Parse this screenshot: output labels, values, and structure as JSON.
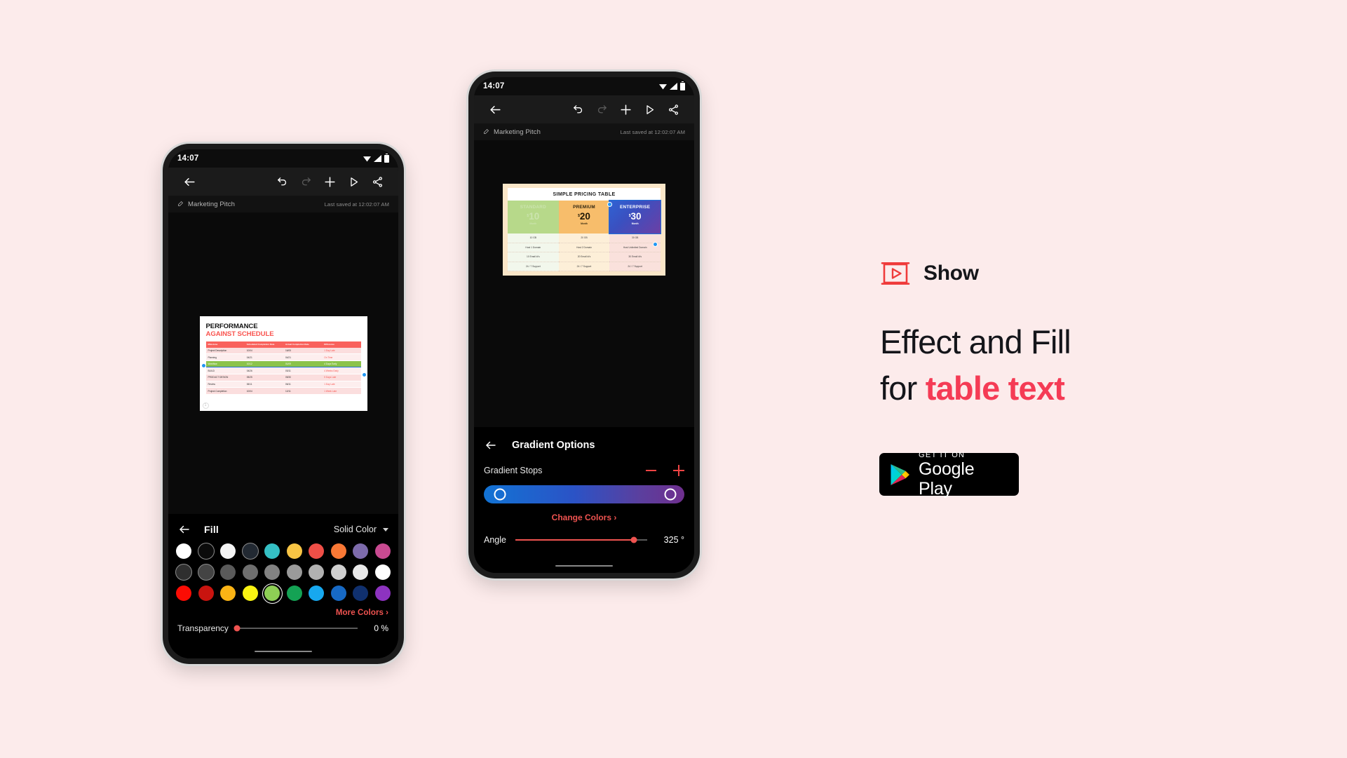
{
  "page": {
    "background": "#fcebeb"
  },
  "phone_left": {
    "status": {
      "time": "14:07",
      "icons": [
        "wifi-icon",
        "signal-icon",
        "battery-icon"
      ]
    },
    "toolbar": {
      "back": "back-arrow-icon",
      "undo": "undo-icon",
      "redo": "redo-icon",
      "add": "plus-icon",
      "present": "play-icon",
      "share": "share-icon"
    },
    "doc": {
      "title": "Marketing Pitch",
      "saved": "Last saved at 12:02:07 AM"
    },
    "slide": {
      "title_line1": "PERFORMANCE",
      "title_line2": "AGAINST SCHEDULE",
      "page_indicator": "1",
      "columns": [
        "Milestone",
        "Scheduled Completion Date",
        "Actual Completion Date",
        "Difference"
      ],
      "rows": [
        {
          "cells": [
            "Project Description",
            "10/04",
            "16/05",
            "1 Day Late"
          ],
          "selected": false
        },
        {
          "cells": [
            "Planning",
            "04/21",
            "04/21",
            "On Time"
          ],
          "selected": false
        },
        {
          "cells": [
            "Workflow",
            "10/12",
            "01/09",
            "4 Days Early"
          ],
          "selected": true
        },
        {
          "cells": [
            "BUILD",
            "04/26",
            "03/11",
            "4 Weeks Early"
          ],
          "selected": false
        },
        {
          "cells": [
            "PRODUCT DESIGN",
            "05/25",
            "05/30",
            "5 Days Late"
          ],
          "selected": false
        },
        {
          "cells": [
            "Review",
            "06/11",
            "06/11",
            "1 Day Late"
          ],
          "selected": false
        },
        {
          "cells": [
            "Project Completion",
            "10/04",
            "12/11",
            "1 Week Late"
          ],
          "selected": false
        }
      ]
    },
    "sheet": {
      "back": "back-arrow-icon",
      "title": "Fill",
      "mode": "Solid Color",
      "mode_caret": "chevron-down-icon",
      "swatch_rows": [
        [
          "#ffffff",
          "#0b0b0b",
          "#f5f5f5",
          "#222932",
          "#35bfc4",
          "#f7c444",
          "#ef4f47",
          "#f97835",
          "#7d6bab",
          "#c94a91"
        ],
        [
          "#2f2f2f",
          "#444444",
          "#5a5a5a",
          "#6e6e6e",
          "#828282",
          "#9a9a9a",
          "#b1b1b1",
          "#cfcfcf",
          "#e8e8e8",
          "#ffffff"
        ],
        [
          "#fb0c04",
          "#c9140f",
          "#fbb415",
          "#f9f312",
          "#8ecf55",
          "#14a254",
          "#17a8ef",
          "#1769c4",
          "#10306e",
          "#8d33c0"
        ]
      ],
      "selected_swatch": {
        "row": 2,
        "index": 4
      },
      "more_colors": "More Colors",
      "more_colors_chevron": "chevron-right-icon",
      "transparency_label": "Transparency",
      "transparency_value": "0 %",
      "transparency_percent": 0
    }
  },
  "phone_right": {
    "status": {
      "time": "14:07",
      "icons": [
        "wifi-icon",
        "signal-icon",
        "battery-icon"
      ]
    },
    "toolbar": {
      "back": "back-arrow-icon",
      "undo": "undo-icon",
      "redo": "redo-icon",
      "add": "plus-icon",
      "present": "play-icon",
      "share": "share-icon"
    },
    "doc": {
      "title": "Marketing Pitch",
      "saved": "Last saved at 12:02:07 AM"
    },
    "slide": {
      "title": "SIMPLE PRICING TABLE",
      "tiers": [
        {
          "name": "STANDARD",
          "currency": "$",
          "price": "10",
          "period": "Month"
        },
        {
          "name": "PREMIUM",
          "currency": "$",
          "price": "20",
          "period": "Month"
        },
        {
          "name": "ENTERPRISE",
          "currency": "$",
          "price": "30",
          "period": "Month"
        }
      ],
      "feature_rows": [
        [
          "10 GB",
          "20 GB",
          "30 GB"
        ],
        [
          "Host 1 Domain",
          "Host 2 Domain",
          "Host Unlimited Domain"
        ],
        [
          "10 Email id's",
          "20 Email id's",
          "30 Email id's"
        ],
        [
          "24 / 7 Support",
          "24 / 7 Support",
          "24 / 7 Support"
        ]
      ]
    },
    "sheet": {
      "back": "back-arrow-icon",
      "title": "Gradient Options",
      "stops_label": "Gradient Stops",
      "stop_remove": "minus-icon",
      "stop_add": "plus-icon",
      "gradient_start_color": "#1273d4",
      "gradient_end_color": "#6f2f8e",
      "change_colors": "Change Colors",
      "change_colors_chevron": "chevron-right-icon",
      "angle_label": "Angle",
      "angle_value": "325 °",
      "angle_percent": 90
    }
  },
  "marketing": {
    "brand_logo": "show-app-icon",
    "brand_name": "Show",
    "headline_line1": "Effect and Fill",
    "headline_line2_prefix": "for ",
    "headline_line2_accent": "table text",
    "store_badge": {
      "icon": "google-play-icon",
      "small_text": "GET IT ON",
      "big_text": "Google Play"
    },
    "accent_color": "#f53b55",
    "brand_red": "#ef3b3b"
  }
}
